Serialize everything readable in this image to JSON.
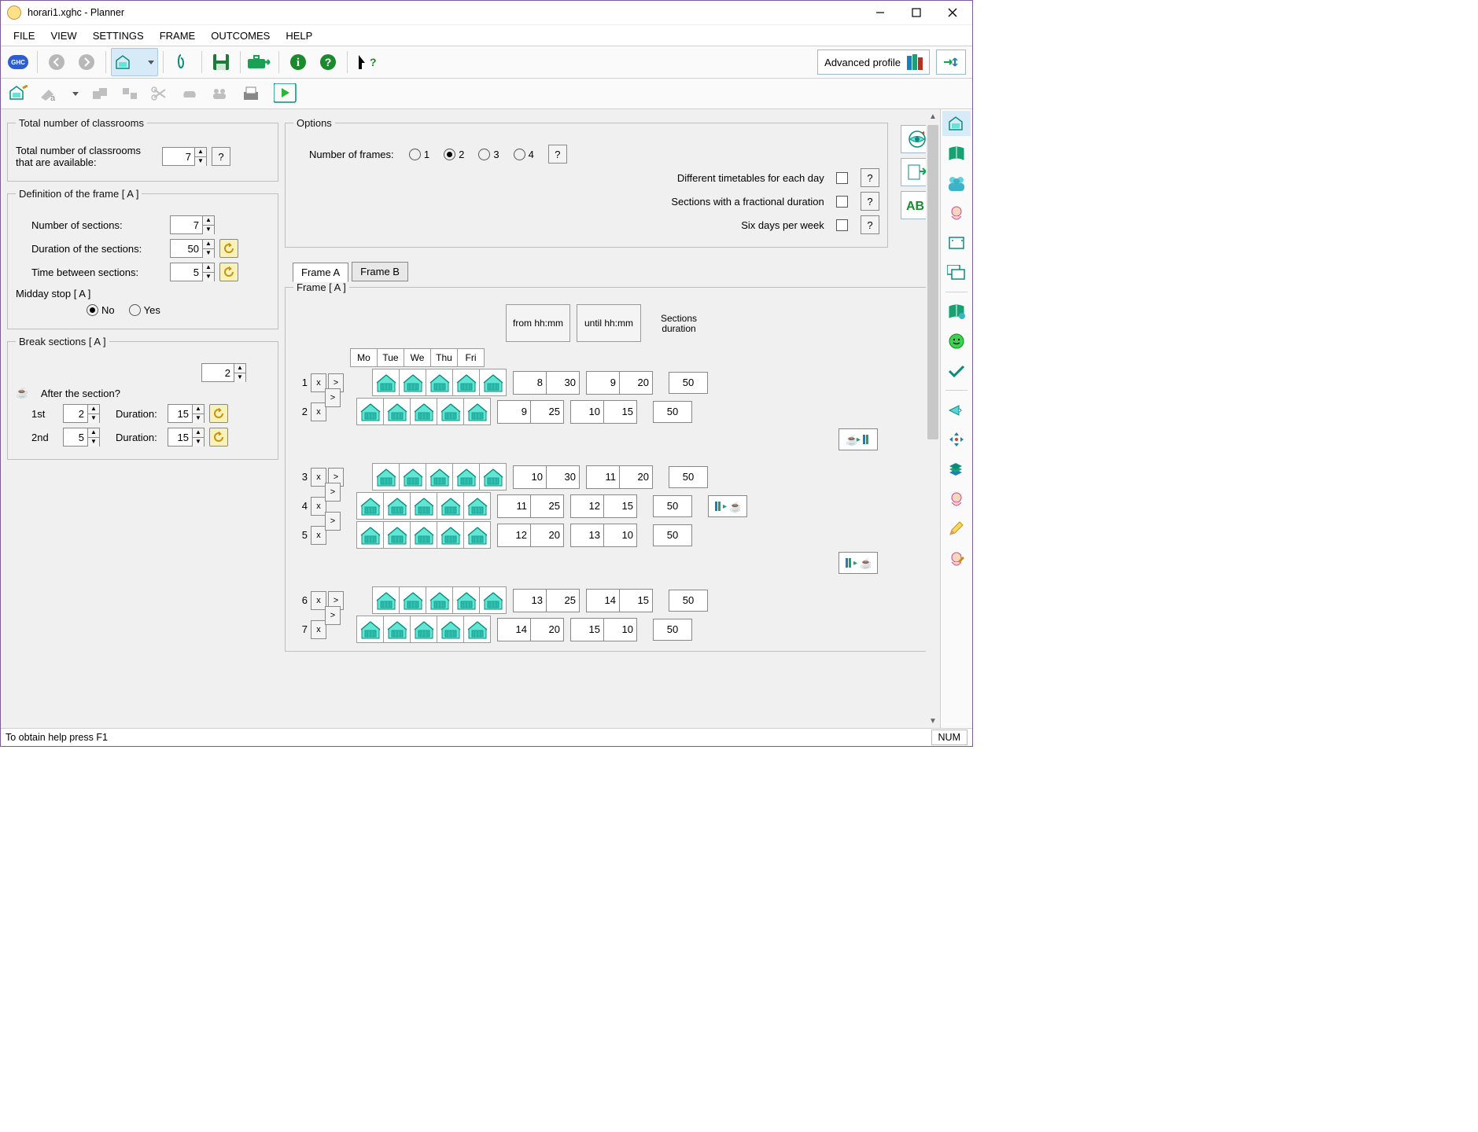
{
  "title": "horari1.xghc - Planner",
  "menu": [
    "FILE",
    "VIEW",
    "SETTINGS",
    "FRAME",
    "OUTCOMES",
    "HELP"
  ],
  "profile_label": "Advanced profile",
  "classrooms": {
    "legend": "Total number of classrooms",
    "label": "Total number of classrooms that are available:",
    "value": "7"
  },
  "frame_def": {
    "legend": "Definition of the frame [ A ]",
    "num_sections_label": "Number of sections:",
    "num_sections": "7",
    "duration_label": "Duration of the sections:",
    "duration": "50",
    "between_label": "Time between sections:",
    "between": "5",
    "midday_legend": "Midday stop [ A ]",
    "no": "No",
    "yes": "Yes"
  },
  "breaks": {
    "legend": "Break sections [ A ]",
    "count": "2",
    "after_label": "After the section?",
    "r1_label": "1st",
    "r1_sec": "2",
    "r1_durlabel": "Duration:",
    "r1_dur": "15",
    "r2_label": "2nd",
    "r2_sec": "5",
    "r2_durlabel": "Duration:",
    "r2_dur": "15"
  },
  "options": {
    "legend": "Options",
    "numframes_label": "Number of frames:",
    "opt1": "1",
    "opt2": "2",
    "opt3": "3",
    "opt4": "4",
    "diff_label": "Different timetables for each day",
    "frac_label": "Sections with a fractional duration",
    "six_label": "Six days per week"
  },
  "tabs": {
    "a": "Frame A",
    "b": "Frame B"
  },
  "framebox": {
    "legend": "Frame [ A ]",
    "days": [
      "Mo",
      "Tue",
      "We",
      "Thu",
      "Fri"
    ],
    "from_label": "from hh:mm",
    "until_label": "until hh:mm",
    "secdur_label": "Sections duration",
    "rows": [
      {
        "n": "1",
        "fh": "8",
        "fm": "30",
        "uh": "9",
        "um": "20",
        "dur": "50"
      },
      {
        "n": "2",
        "fh": "9",
        "fm": "25",
        "uh": "10",
        "um": "15",
        "dur": "50"
      },
      {
        "n": "3",
        "fh": "10",
        "fm": "30",
        "uh": "11",
        "um": "20",
        "dur": "50"
      },
      {
        "n": "4",
        "fh": "11",
        "fm": "25",
        "uh": "12",
        "um": "15",
        "dur": "50"
      },
      {
        "n": "5",
        "fh": "12",
        "fm": "20",
        "uh": "13",
        "um": "10",
        "dur": "50"
      },
      {
        "n": "6",
        "fh": "13",
        "fm": "25",
        "uh": "14",
        "um": "15",
        "dur": "50"
      },
      {
        "n": "7",
        "fh": "14",
        "fm": "20",
        "uh": "15",
        "um": "10",
        "dur": "50"
      }
    ]
  },
  "status": "To obtain help press F1",
  "num": "NUM"
}
